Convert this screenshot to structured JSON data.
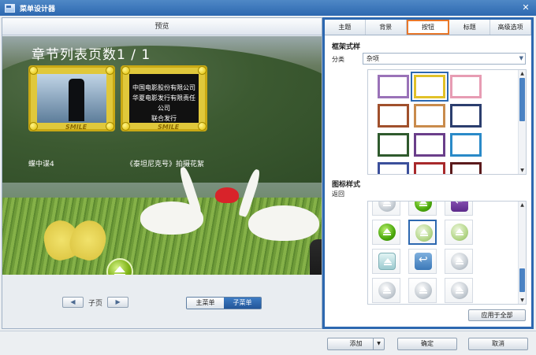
{
  "window": {
    "title": "菜单设计器",
    "close_glyph": "✕"
  },
  "preview": {
    "header": "预览",
    "chapter_title": "章节列表页数1 / 1",
    "thumbnails": [
      {
        "caption": "蝶中谍4",
        "badge": "SMILE"
      },
      {
        "caption": "《泰坦尼克号》拍摄花絮",
        "badge": "SMILE",
        "text_lines": [
          "中国电影股份有限公司",
          "华夏电影发行有限责任公司",
          "联合发行"
        ]
      }
    ],
    "pager": {
      "prev_glyph": "◀",
      "label": "子页",
      "next_glyph": "▶"
    },
    "menu_toggle": {
      "main": "主菜单",
      "sub": "子菜单",
      "active": "sub"
    }
  },
  "panel": {
    "tabs": [
      {
        "label": "主题",
        "active": false
      },
      {
        "label": "背景",
        "active": false
      },
      {
        "label": "按钮",
        "active": true
      },
      {
        "label": "标题",
        "active": false
      },
      {
        "label": "高级选项",
        "active": false
      }
    ],
    "frame_section": {
      "title": "框架式样",
      "category_label": "分类",
      "category_value": "杂项",
      "frames": [
        {
          "color": "#9a72b8",
          "selected": false
        },
        {
          "color": "#e1c128",
          "selected": true
        },
        {
          "color": "#e79cb3",
          "selected": false
        },
        {
          "color": "#a0502c",
          "selected": false
        },
        {
          "color": "#c98b4c",
          "selected": false
        },
        {
          "color": "#2b3e6e",
          "selected": false
        },
        {
          "color": "#2f5a2d",
          "selected": false
        },
        {
          "color": "#6a3e8a",
          "selected": false
        },
        {
          "color": "#2a8ac8",
          "selected": false
        },
        {
          "color": "#3b4f9b",
          "selected": false
        },
        {
          "color": "#a8292b",
          "selected": false
        },
        {
          "color": "#5b1a1c",
          "selected": false
        }
      ]
    },
    "icon_section": {
      "title": "图标样式",
      "subtitle": "返回",
      "icons": [
        {
          "style": "grey",
          "selected": false
        },
        {
          "style": "green",
          "selected": false
        },
        {
          "style": "purple",
          "selected": false
        },
        {
          "style": "green",
          "selected": false
        },
        {
          "style": "lightgreen",
          "selected": true
        },
        {
          "style": "lightgreen",
          "selected": false
        },
        {
          "style": "teal",
          "selected": false
        },
        {
          "style": "blue",
          "selected": false
        },
        {
          "style": "grey",
          "selected": false
        },
        {
          "style": "grey",
          "selected": false
        },
        {
          "style": "grey",
          "selected": false
        },
        {
          "style": "grey",
          "selected": false
        }
      ]
    },
    "apply_all": "应用于全部"
  },
  "footer": {
    "add": "添加",
    "add_dropdown_glyph": "▼",
    "ok": "确定",
    "cancel": "取消"
  },
  "colors": {
    "accent": "#2d68b0",
    "tab_highlight": "#e8772a",
    "selection": "#2d68b0"
  }
}
